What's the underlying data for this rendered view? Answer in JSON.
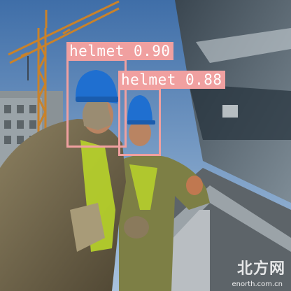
{
  "detections": [
    {
      "label": "helmet 0.90"
    },
    {
      "label": "helmet 0.88"
    }
  ],
  "watermark": {
    "logo_text": "北方网",
    "url_text": "enorth.com.cn"
  },
  "colors": {
    "box": "#f0a0a0",
    "sky": "#5f86b8",
    "helmet": "#1f6fd0",
    "vest": "#b8d42a"
  }
}
